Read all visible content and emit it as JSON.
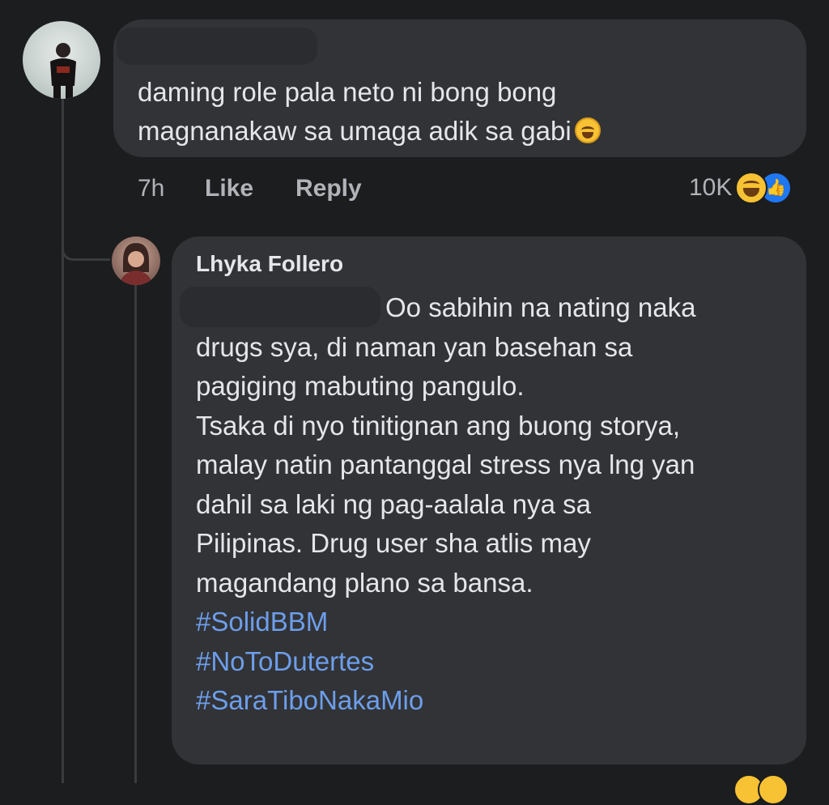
{
  "comment": {
    "text_line_1": "daming role pala neto ni bong bong",
    "text_line_2": "magnanakaw sa umaga adik sa gabi",
    "emoji": "rolling-laughing-emoji",
    "time": "7h",
    "like_label": "Like",
    "reply_label": "Reply",
    "reaction_count": "10K",
    "reaction_icons": [
      "haha-icon",
      "like-icon"
    ]
  },
  "reply": {
    "author": "Lhyka Follero",
    "lines": [
      "Oo sabihin na nating naka",
      "drugs sya, di naman yan basehan sa",
      "pagiging mabuting pangulo.",
      "Tsaka di nyo tinitignan ang buong storya,",
      "malay natin pantanggal stress nya lng yan",
      "dahil sa laki ng pag-aalala nya sa",
      "Pilipinas. Drug user sha atlis may",
      "magandang plano sa bansa."
    ],
    "hashtags": [
      "#SolidBBM",
      "#NoToDutertes",
      "#SaraTiboNakaMio"
    ]
  },
  "colors": {
    "background": "#1c1d1f",
    "bubble": "#323336",
    "text": "#e4e6eb",
    "muted": "#b0b3b8",
    "hashtag": "#6d9eeb",
    "like_blue": "#1f77f2"
  }
}
